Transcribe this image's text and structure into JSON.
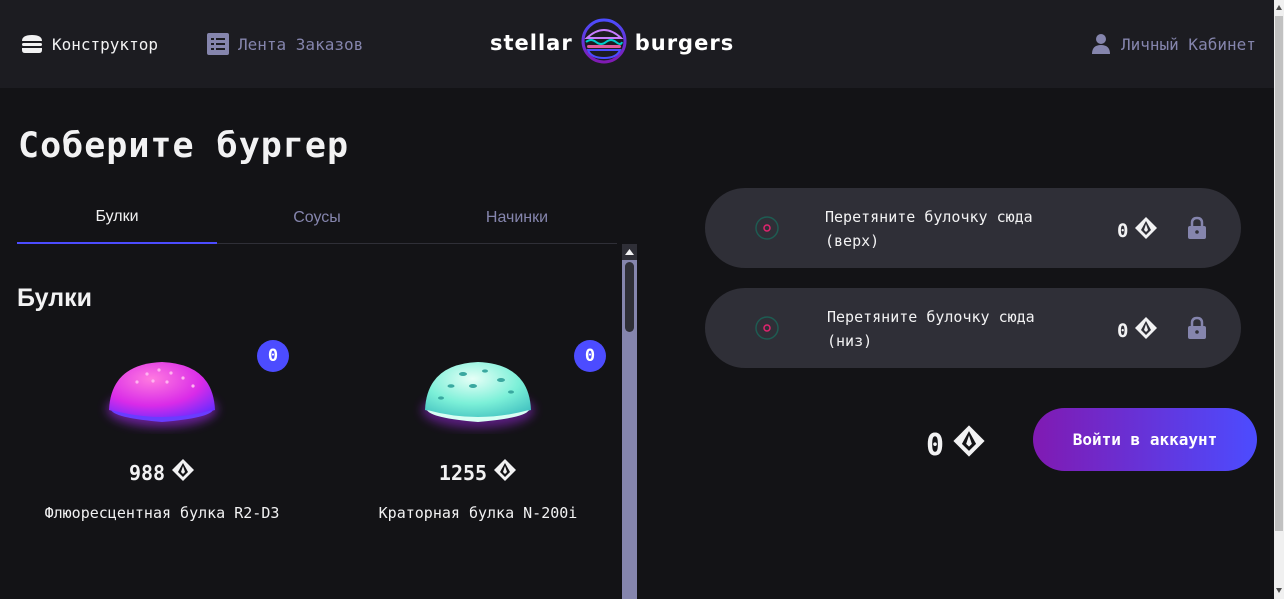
{
  "header": {
    "constructor_label": "Конструктор",
    "feed_label": "Лента Заказов",
    "profile_label": "Личный Кабинет",
    "logo_left": "stellar",
    "logo_right": "burgers"
  },
  "main": {
    "title": "Соберите бургер",
    "tabs": [
      {
        "label": "Булки"
      },
      {
        "label": "Соусы"
      },
      {
        "label": "Начинки"
      }
    ],
    "section_title": "Булки",
    "ingredients": [
      {
        "name": "Флюоресцентная булка R2-D3",
        "price": "988",
        "count": "0"
      },
      {
        "name": "Краторная булка N-200i",
        "price": "1255",
        "count": "0"
      }
    ]
  },
  "constructor": {
    "top_slot": {
      "line1": "Перетяните булочку сюда",
      "line2": "(верх)",
      "price": "0"
    },
    "bottom_slot": {
      "line1": "Перетяните булочку сюда",
      "line2": "(низ)",
      "price": "0"
    },
    "total": "0",
    "order_button": "Войти в аккаунт"
  },
  "colors": {
    "background": "#131316",
    "header_bg": "#1c1c21",
    "accent": "#4c4cff",
    "muted": "#8585ad",
    "slot_bg": "#2f2f37",
    "gradient_start": "#801ab2",
    "gradient_end": "#4c4cff"
  },
  "icons": [
    "burger-icon",
    "list-icon",
    "profile-icon",
    "currency-icon",
    "lock-icon",
    "bun-placeholder-icon"
  ]
}
